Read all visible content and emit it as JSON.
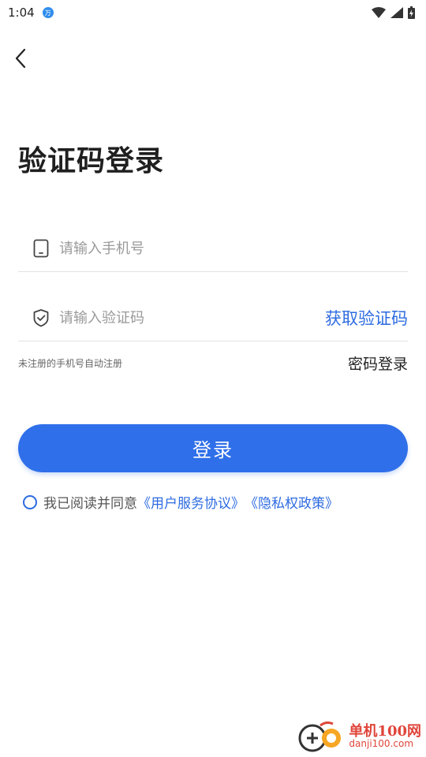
{
  "status_bar": {
    "time": "1:04",
    "app_badge": "万"
  },
  "page": {
    "title": "验证码登录",
    "phone_placeholder": "请输入手机号",
    "code_placeholder": "请输入验证码",
    "get_code_label": "获取验证码",
    "hint": "未注册的手机号自动注册",
    "password_login_label": "密码登录",
    "login_button": "登录",
    "agreement_prefix": "我已阅读并同意",
    "user_agreement": "《用户服务协议》",
    "privacy_policy": "《隐私权政策》"
  },
  "watermark": {
    "title": "单机100网",
    "url": "danji100.com"
  },
  "colors": {
    "accent": "#2f6fe9",
    "link": "#2d6be0",
    "watermark": "#e0453a"
  }
}
